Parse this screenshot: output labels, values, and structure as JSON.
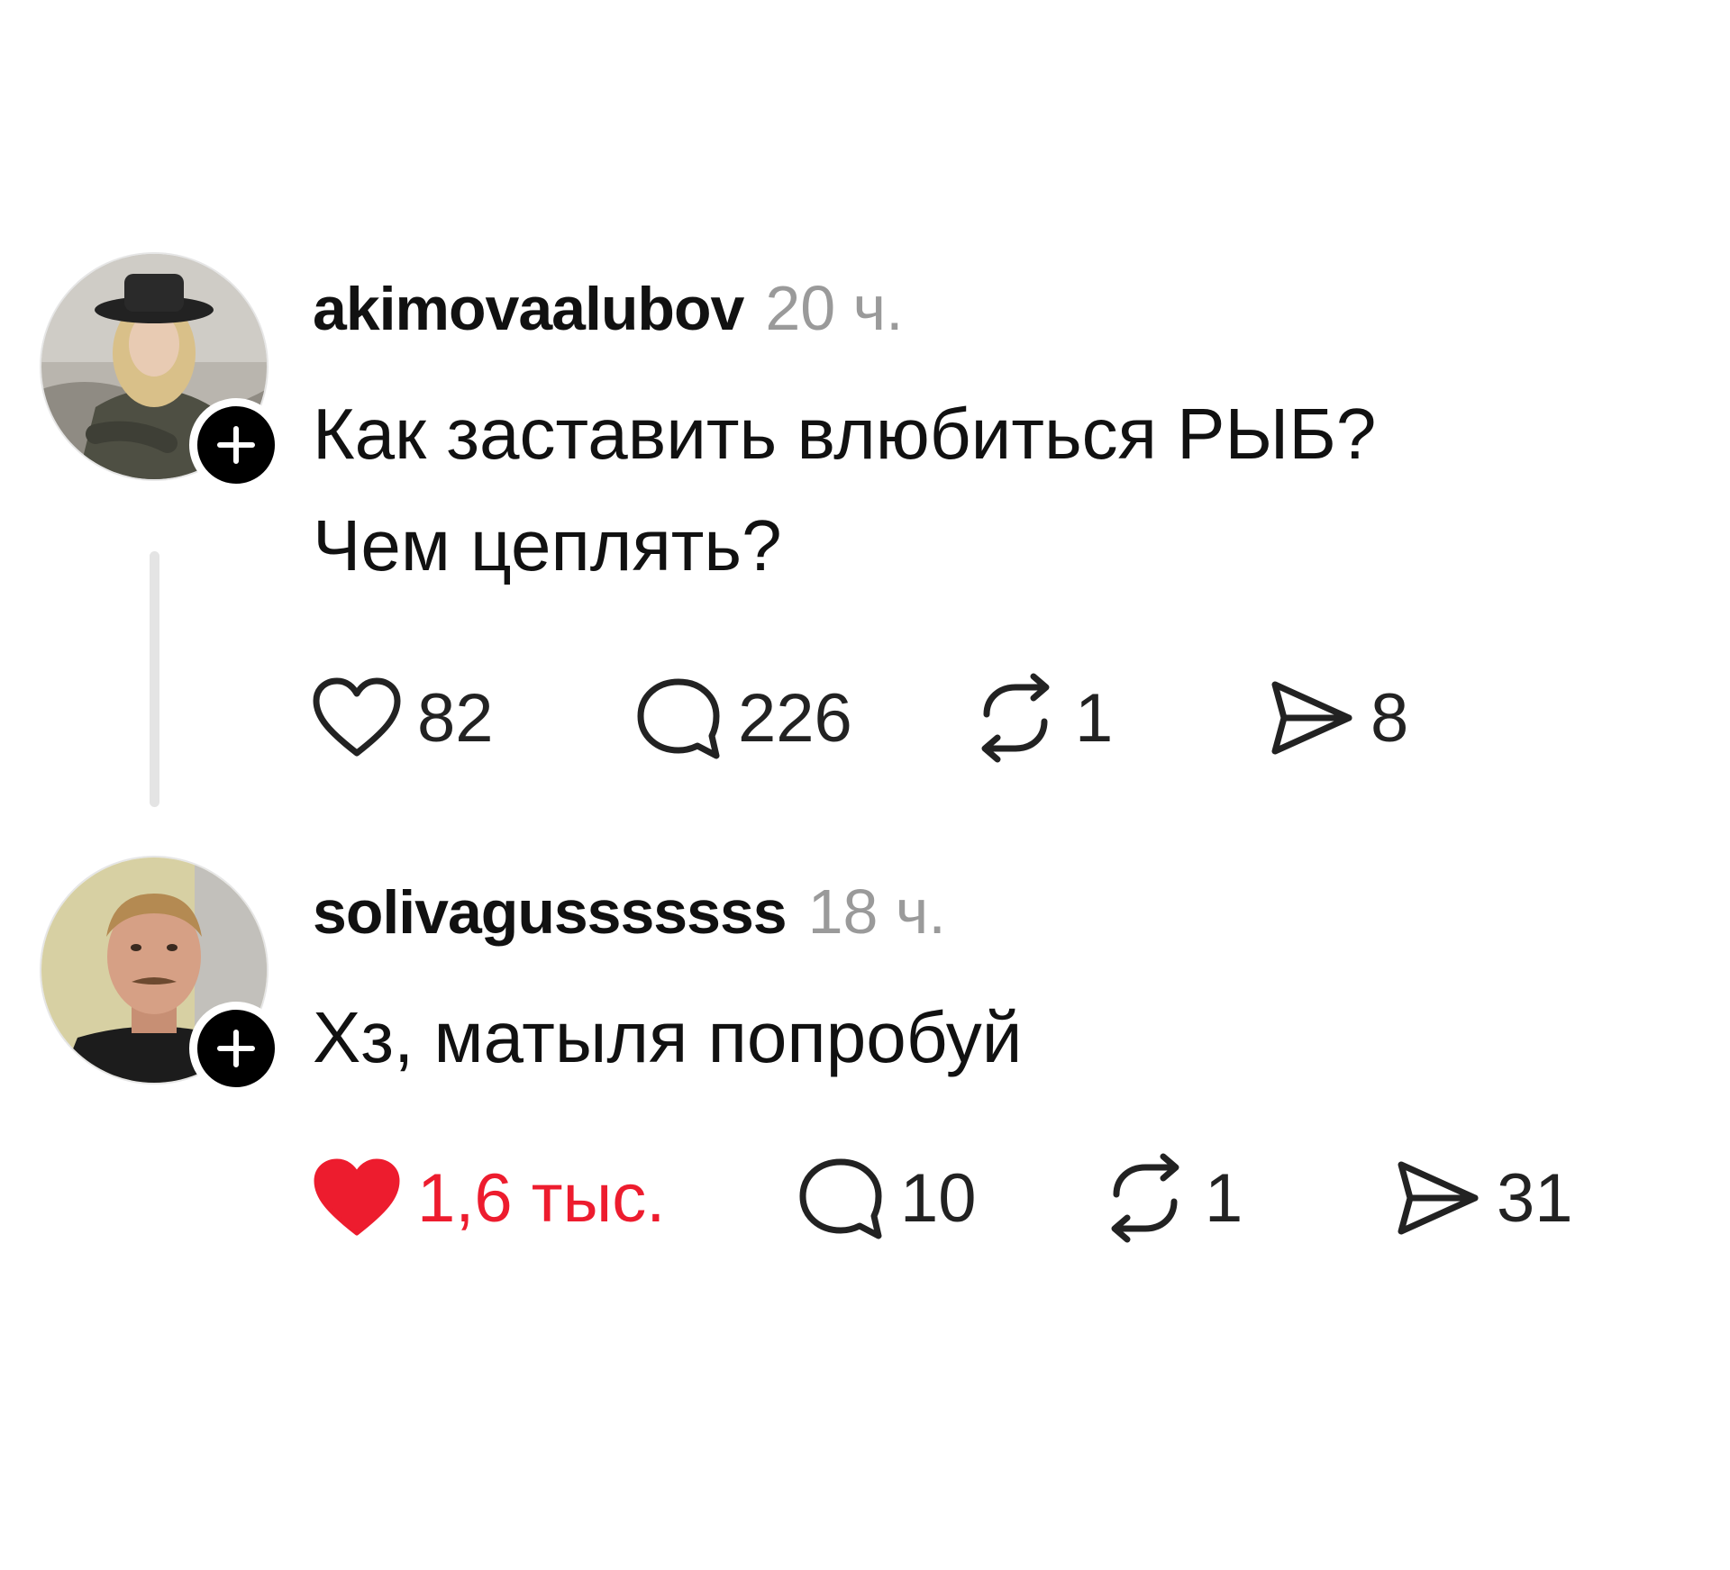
{
  "posts": [
    {
      "username": "akimovaalubov",
      "time": "20 ч.",
      "text_lines": [
        "Как заставить влюбиться РЫБ?",
        "Чем цеплять?"
      ],
      "liked": false,
      "counts": {
        "likes": "82",
        "comments": "226",
        "reposts": "1",
        "shares": "8"
      }
    },
    {
      "username": "solivagusssssss",
      "time": "18 ч.",
      "text_lines": [
        "Хз, матыля попробуй"
      ],
      "liked": true,
      "counts": {
        "likes": "1,6 тыс.",
        "comments": "10",
        "reposts": "1",
        "shares": "31"
      }
    }
  ],
  "icons": {
    "like": "heart-icon",
    "comment": "speech-bubble-icon",
    "repost": "repost-arrows-icon",
    "share": "paper-plane-icon",
    "follow": "plus-icon"
  },
  "colors": {
    "liked": "#ed1c2e",
    "meta": "#9a9a9a",
    "text": "#111111",
    "thread_line": "#e4e4e4"
  }
}
